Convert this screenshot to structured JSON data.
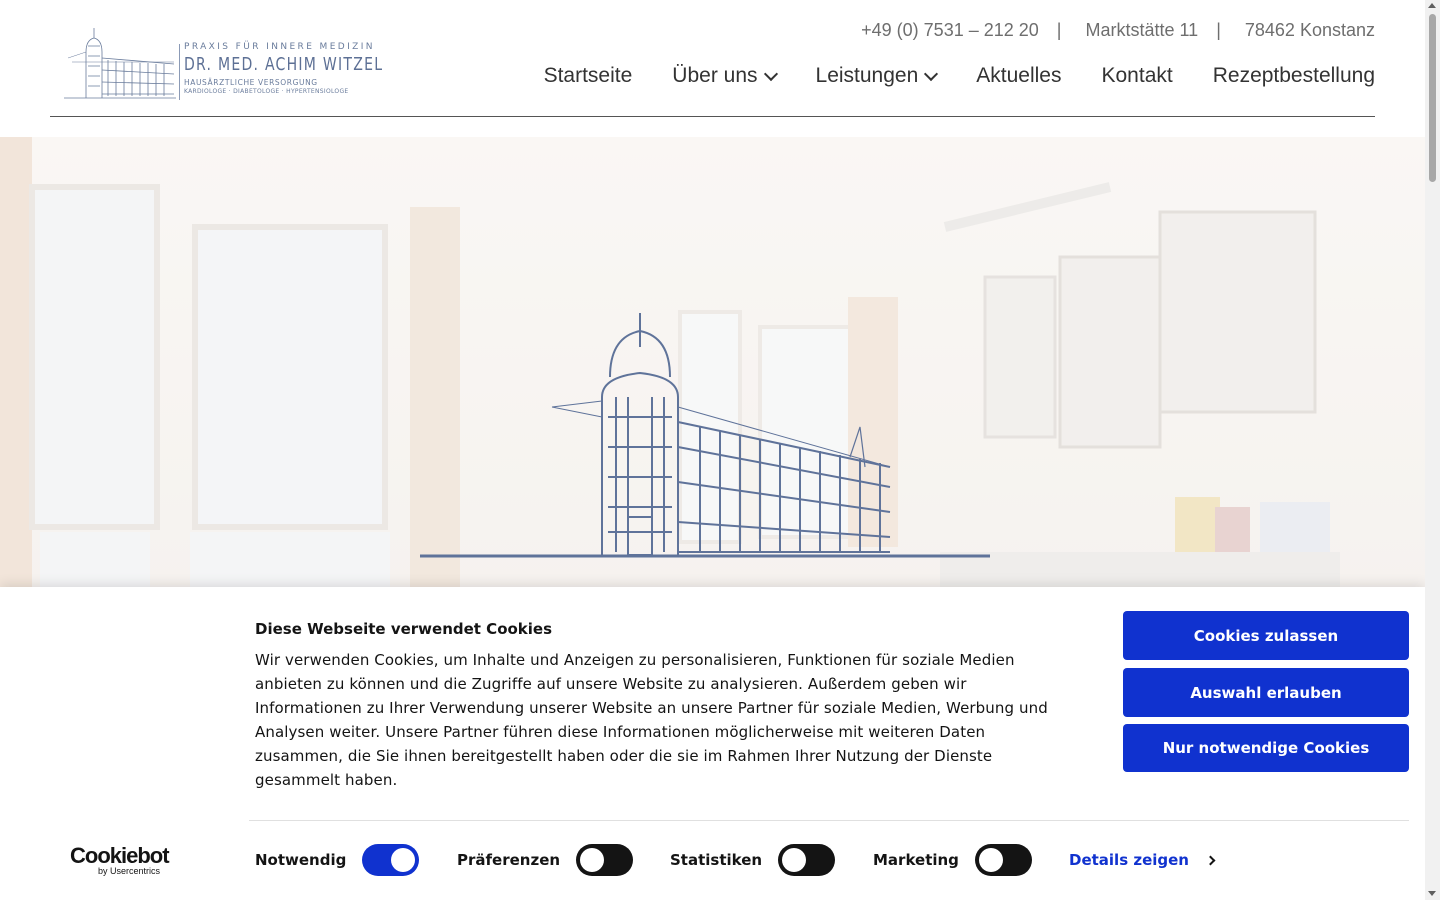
{
  "header": {
    "logo": {
      "line1": "PRAXIS FÜR INNERE MEDIZIN",
      "line2": "DR. MED. ACHIM WITZEL",
      "line3": "HAUSÄRZTLICHE VERSORGUNG",
      "line4": "KARDIOLOGE · DIABETOLOGE · HYPERTENSIOLOGE"
    },
    "contact": {
      "phone": "+49 (0) 7531 – 212 20",
      "separator": "|",
      "street": "Marktstätte 11",
      "city": "78462 Konstanz"
    },
    "nav": [
      {
        "label": "Startseite"
      },
      {
        "label": "Über uns"
      },
      {
        "label": "Leistungen"
      },
      {
        "label": "Aktuelles"
      },
      {
        "label": "Kontakt"
      },
      {
        "label": "Rezeptbestellung"
      }
    ]
  },
  "cookie_banner": {
    "title": "Diese Webseite verwendet Cookies",
    "text": "Wir verwenden Cookies, um Inhalte und Anzeigen zu personalisieren, Funktionen für soziale Medien anbieten zu können und die Zugriffe auf unsere Website zu analysieren. Außerdem geben wir Informationen zu Ihrer Verwendung unserer Website an unsere Partner für soziale Medien, Werbung und Analysen weiter. Unsere Partner führen diese Informationen möglicherweise mit weiteren Daten zusammen, die Sie ihnen bereitgestellt haben oder die sie im Rahmen Ihrer Nutzung der Dienste gesammelt haben.",
    "buttons": {
      "allow_all": "Cookies zulassen",
      "allow_selection": "Auswahl erlauben",
      "necessary_only": "Nur notwendige Cookies"
    },
    "toggles": [
      {
        "label": "Notwendig",
        "on": true
      },
      {
        "label": "Präferenzen",
        "on": false
      },
      {
        "label": "Statistiken",
        "on": false
      },
      {
        "label": "Marketing",
        "on": false
      }
    ],
    "details_link": "Details zeigen",
    "brand": {
      "main": "Cookiebot",
      "sub": "by Usercentrics"
    },
    "accent_color": "#1032cf"
  }
}
